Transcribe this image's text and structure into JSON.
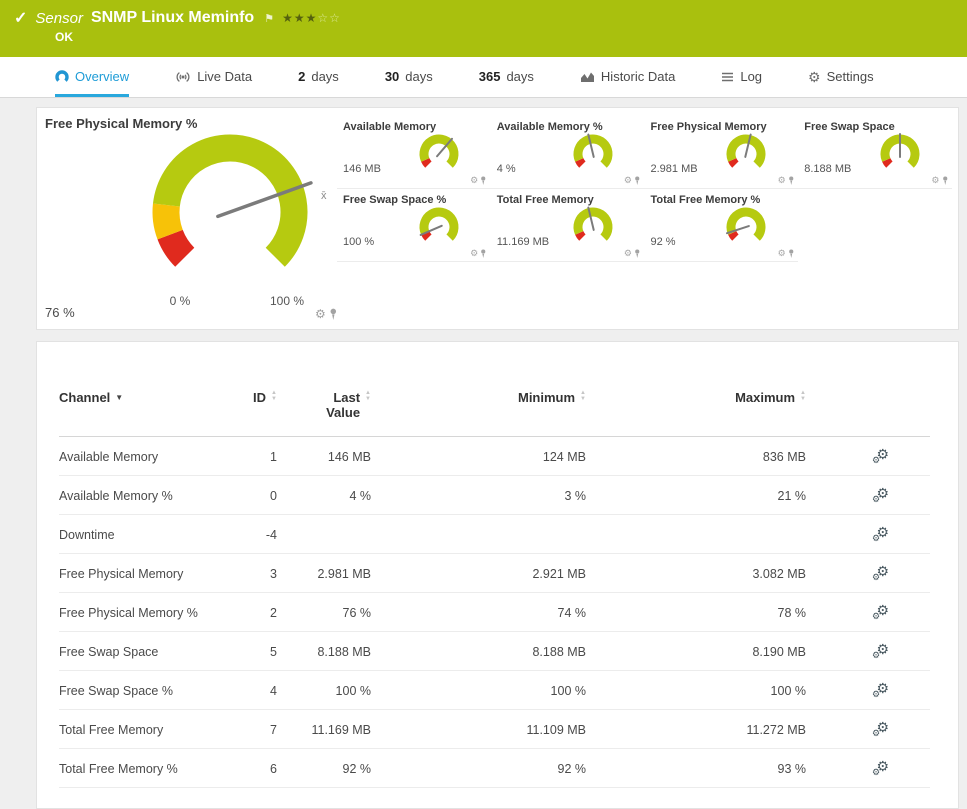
{
  "header": {
    "kind_label": "Sensor",
    "title": "SNMP Linux Meminfo",
    "status": "OK",
    "rating": {
      "filled": 3,
      "total": 5
    }
  },
  "tabs": [
    {
      "label": "Overview"
    },
    {
      "label": "Live Data"
    },
    {
      "num": "2",
      "unit": "days"
    },
    {
      "num": "30",
      "unit": "days"
    },
    {
      "num": "365",
      "unit": "days"
    },
    {
      "label": "Historic Data"
    },
    {
      "label": "Log"
    },
    {
      "label": "Settings"
    }
  ],
  "colors": {
    "header_green": "#a9c00e",
    "active_tab_blue": "#1e9cd7",
    "gauge_green": "#b6ca10",
    "gauge_yellow": "#f7c208",
    "gauge_red": "#e02a1e"
  },
  "chart_data": {
    "type": "gauge",
    "main_gauge": {
      "title": "Free Physical Memory %",
      "value_label": "76 %",
      "value_pct": 76,
      "min_label": "0 %",
      "max_label": "100 %",
      "avg_marker": "x̄",
      "segments": [
        {
          "from": 0,
          "to": 9,
          "color": "#e02a1e"
        },
        {
          "from": 9,
          "to": 19,
          "color": "#f7c208"
        },
        {
          "from": 19,
          "to": 100,
          "color": "#b6ca10"
        }
      ]
    },
    "mini_segments": [
      {
        "from": 0,
        "to": 8,
        "color": "#e02a1e"
      },
      {
        "from": 8,
        "to": 100,
        "color": "#b6ca10"
      }
    ],
    "mini_gauges": [
      {
        "title": "Available Memory",
        "value_label": "146 MB",
        "needle_pct": 65
      },
      {
        "title": "Available Memory %",
        "value_label": "4 %",
        "needle_pct": 45
      },
      {
        "title": "Free Physical Memory",
        "value_label": "2.981 MB",
        "needle_pct": 55
      },
      {
        "title": "Free Swap Space",
        "value_label": "8.188 MB",
        "needle_pct": 50
      },
      {
        "title": "Free Swap Space %",
        "value_label": "100 %",
        "needle_pct": 8
      },
      {
        "title": "Total Free Memory",
        "value_label": "11.169 MB",
        "needle_pct": 45
      },
      {
        "title": "Total Free Memory %",
        "value_label": "92 %",
        "needle_pct": 10
      }
    ]
  },
  "table": {
    "columns": [
      "Channel",
      "ID",
      "Last Value",
      "Minimum",
      "Maximum"
    ],
    "rows": [
      {
        "channel": "Available Memory",
        "id": "1",
        "last": "146 MB",
        "min": "124 MB",
        "max": "836 MB"
      },
      {
        "channel": "Available Memory %",
        "id": "0",
        "last": "4 %",
        "min": "3 %",
        "max": "21 %"
      },
      {
        "channel": "Downtime",
        "id": "-4",
        "last": "",
        "min": "",
        "max": ""
      },
      {
        "channel": "Free Physical Memory",
        "id": "3",
        "last": "2.981 MB",
        "min": "2.921 MB",
        "max": "3.082 MB"
      },
      {
        "channel": "Free Physical Memory %",
        "id": "2",
        "last": "76 %",
        "min": "74 %",
        "max": "78 %"
      },
      {
        "channel": "Free Swap Space",
        "id": "5",
        "last": "8.188 MB",
        "min": "8.188 MB",
        "max": "8.190 MB"
      },
      {
        "channel": "Free Swap Space %",
        "id": "4",
        "last": "100 %",
        "min": "100 %",
        "max": "100 %"
      },
      {
        "channel": "Total Free Memory",
        "id": "7",
        "last": "11.169 MB",
        "min": "11.109 MB",
        "max": "11.272 MB"
      },
      {
        "channel": "Total Free Memory %",
        "id": "6",
        "last": "92 %",
        "min": "92 %",
        "max": "93 %"
      }
    ]
  }
}
